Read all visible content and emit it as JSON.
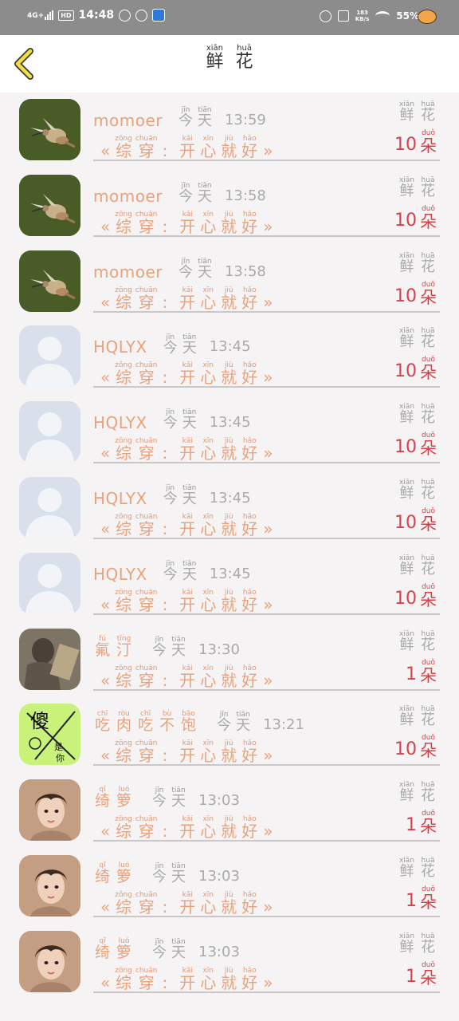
{
  "status_bar": {
    "network": "4G+",
    "hd": "HD",
    "time": "14:48",
    "speed_value": "183",
    "speed_unit": "KB/s",
    "battery": "55%"
  },
  "header": {
    "title": [
      {
        "hanzi": "鲜",
        "pinyin": "xiān"
      },
      {
        "hanzi": "花",
        "pinyin": "huā"
      }
    ]
  },
  "labels": {
    "today": [
      {
        "hanzi": "今",
        "pinyin": "jīn"
      },
      {
        "hanzi": "天",
        "pinyin": "tiān"
      }
    ],
    "flower": [
      {
        "hanzi": "鲜",
        "pinyin": "xiān"
      },
      {
        "hanzi": "花",
        "pinyin": "huā"
      }
    ],
    "unit": {
      "hanzi": "朵",
      "pinyin": "duǒ"
    },
    "open_bracket": "«",
    "close_bracket": "»",
    "colon": ":",
    "book_left": [
      {
        "hanzi": "综",
        "pinyin": "zōng"
      },
      {
        "hanzi": "穿",
        "pinyin": "chuān"
      }
    ],
    "book_right": [
      {
        "hanzi": "开",
        "pinyin": "kāi"
      },
      {
        "hanzi": "心",
        "pinyin": "xīn"
      },
      {
        "hanzi": "就",
        "pinyin": "jiù"
      },
      {
        "hanzi": "好",
        "pinyin": "hǎo"
      }
    ]
  },
  "items": [
    {
      "name_latin": "momoer",
      "name_chars": [],
      "time": "13:59",
      "count": "10",
      "avatar": "bird"
    },
    {
      "name_latin": "momoer",
      "name_chars": [],
      "time": "13:58",
      "count": "10",
      "avatar": "bird"
    },
    {
      "name_latin": "momoer",
      "name_chars": [],
      "time": "13:58",
      "count": "10",
      "avatar": "bird"
    },
    {
      "name_latin": "HQLYX",
      "name_chars": [],
      "time": "13:45",
      "count": "10",
      "avatar": "default"
    },
    {
      "name_latin": "HQLYX",
      "name_chars": [],
      "time": "13:45",
      "count": "10",
      "avatar": "default"
    },
    {
      "name_latin": "HQLYX",
      "name_chars": [],
      "time": "13:45",
      "count": "10",
      "avatar": "default"
    },
    {
      "name_latin": "HQLYX",
      "name_chars": [],
      "time": "13:45",
      "count": "10",
      "avatar": "default"
    },
    {
      "name_latin": "",
      "name_chars": [
        {
          "hanzi": "氟",
          "pinyin": "fú"
        },
        {
          "hanzi": "汀",
          "pinyin": "tīng"
        }
      ],
      "time": "13:30",
      "count": "1",
      "avatar": "photo-gray"
    },
    {
      "name_latin": "",
      "name_chars": [
        {
          "hanzi": "吃",
          "pinyin": "chī"
        },
        {
          "hanzi": "肉",
          "pinyin": "ròu"
        },
        {
          "hanzi": "吃",
          "pinyin": "chī"
        },
        {
          "hanzi": "不",
          "pinyin": "bù"
        },
        {
          "hanzi": "饱",
          "pinyin": "bǎo"
        }
      ],
      "time": "13:21",
      "count": "10",
      "avatar": "meme"
    },
    {
      "name_latin": "",
      "name_chars": [
        {
          "hanzi": "绮",
          "pinyin": "qǐ"
        },
        {
          "hanzi": "箩",
          "pinyin": "luó"
        }
      ],
      "time": "13:03",
      "count": "1",
      "avatar": "girl"
    },
    {
      "name_latin": "",
      "name_chars": [
        {
          "hanzi": "绮",
          "pinyin": "qǐ"
        },
        {
          "hanzi": "箩",
          "pinyin": "luó"
        }
      ],
      "time": "13:03",
      "count": "1",
      "avatar": "girl"
    },
    {
      "name_latin": "",
      "name_chars": [
        {
          "hanzi": "绮",
          "pinyin": "qǐ"
        },
        {
          "hanzi": "箩",
          "pinyin": "luó"
        }
      ],
      "time": "13:03",
      "count": "1",
      "avatar": "girl"
    }
  ],
  "meme_text": {
    "big": "傻",
    "small1": "是",
    "small2": "你"
  }
}
